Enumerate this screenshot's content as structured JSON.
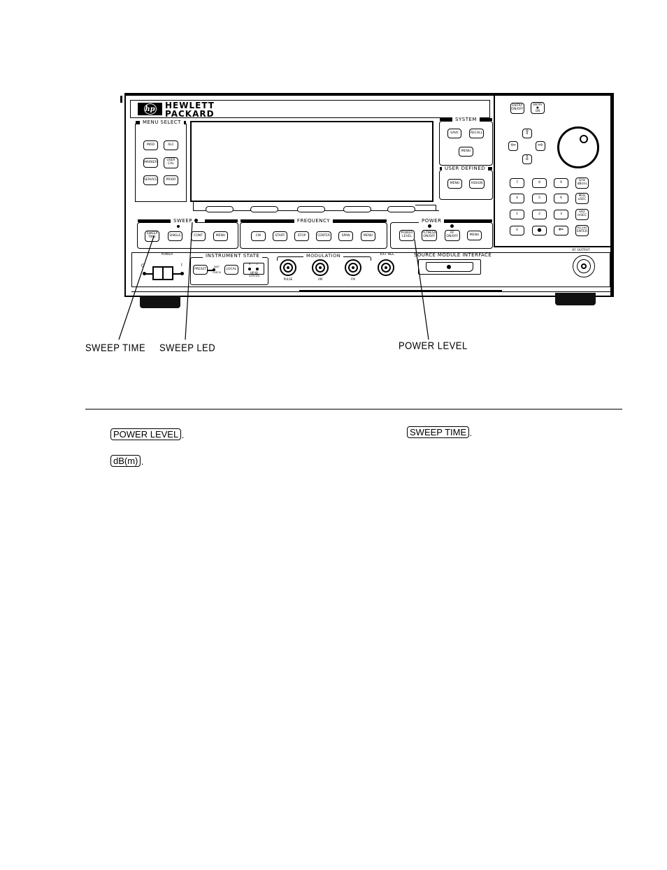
{
  "brand": {
    "logo": "hp",
    "line1": "HEWLETT",
    "line2": "PACKARD"
  },
  "menu_select": {
    "title": "MENU SELECT",
    "keys": [
      "MOD",
      "ALC",
      "MARKER",
      "USER\nCAL",
      "SERVICE",
      "PRIOR"
    ]
  },
  "system": {
    "title": "SYSTEM",
    "keys": [
      "SAVE",
      "RECALL",
      "MENU"
    ]
  },
  "user_defined": {
    "title": "USER DEFINED",
    "keys": [
      "MENU",
      "ASSIGN"
    ]
  },
  "entry": {
    "keys": [
      "ENTRY\nON/OFF",
      "ENTRY\n●\nON"
    ]
  },
  "arrows": [
    "up",
    "left",
    "right",
    "down"
  ],
  "keypad": {
    "rows": [
      [
        "7",
        "8",
        "9",
        "GHz\ndB(m)"
      ],
      [
        "4",
        "5",
        "6",
        "MHz\nuSEC"
      ],
      [
        "1",
        "2",
        "3",
        "kHz\nmSEC"
      ],
      [
        "0",
        "●",
        "⇐",
        "Hz,sec\nENTER"
      ]
    ]
  },
  "sweep": {
    "title": "SWEEP",
    "keys": [
      "SWEEP\nTIME",
      "SINGLE",
      "CONT",
      "MENU"
    ]
  },
  "frequency": {
    "title": "FREQUENCY",
    "keys": [
      "CW",
      "START",
      "STOP",
      "CENTER",
      "SPAN",
      "MENU"
    ]
  },
  "power": {
    "title": "POWER",
    "keys": [
      "POWER\nLEVEL",
      "FLTNESS\nON/OFF",
      "RF\nON/OFF",
      "MENU"
    ]
  },
  "line_power": {
    "label": "POWER",
    "off": "O",
    "on": "I"
  },
  "instrument_state": {
    "title": "INSTRUMENT STATE",
    "keys": [
      "PRESET",
      "LOCAL"
    ],
    "inst_check": "INST\nCHECK",
    "hpib_status": "HP-IB\nSTATUS",
    "hpib_leds": [
      "R",
      "L"
    ]
  },
  "modulation": {
    "title": "MODULATION",
    "inputs": [
      "PULSE",
      "AM",
      "FM"
    ]
  },
  "ext_alc": {
    "label": "EXT ALC"
  },
  "source_module": {
    "label": "SOURCE MODULE INTERFACE"
  },
  "rf_output": {
    "label": "RF OUTPUT"
  },
  "callouts": {
    "sweep_time": "SWEEP TIME",
    "sweep_led": "SWEEP LED",
    "power_level": "POWER LEVEL"
  },
  "instructions": {
    "key_power_level": "POWER LEVEL",
    "key_sweep_time": "SWEEP TIME",
    "key_dbm": "dB(m)"
  }
}
